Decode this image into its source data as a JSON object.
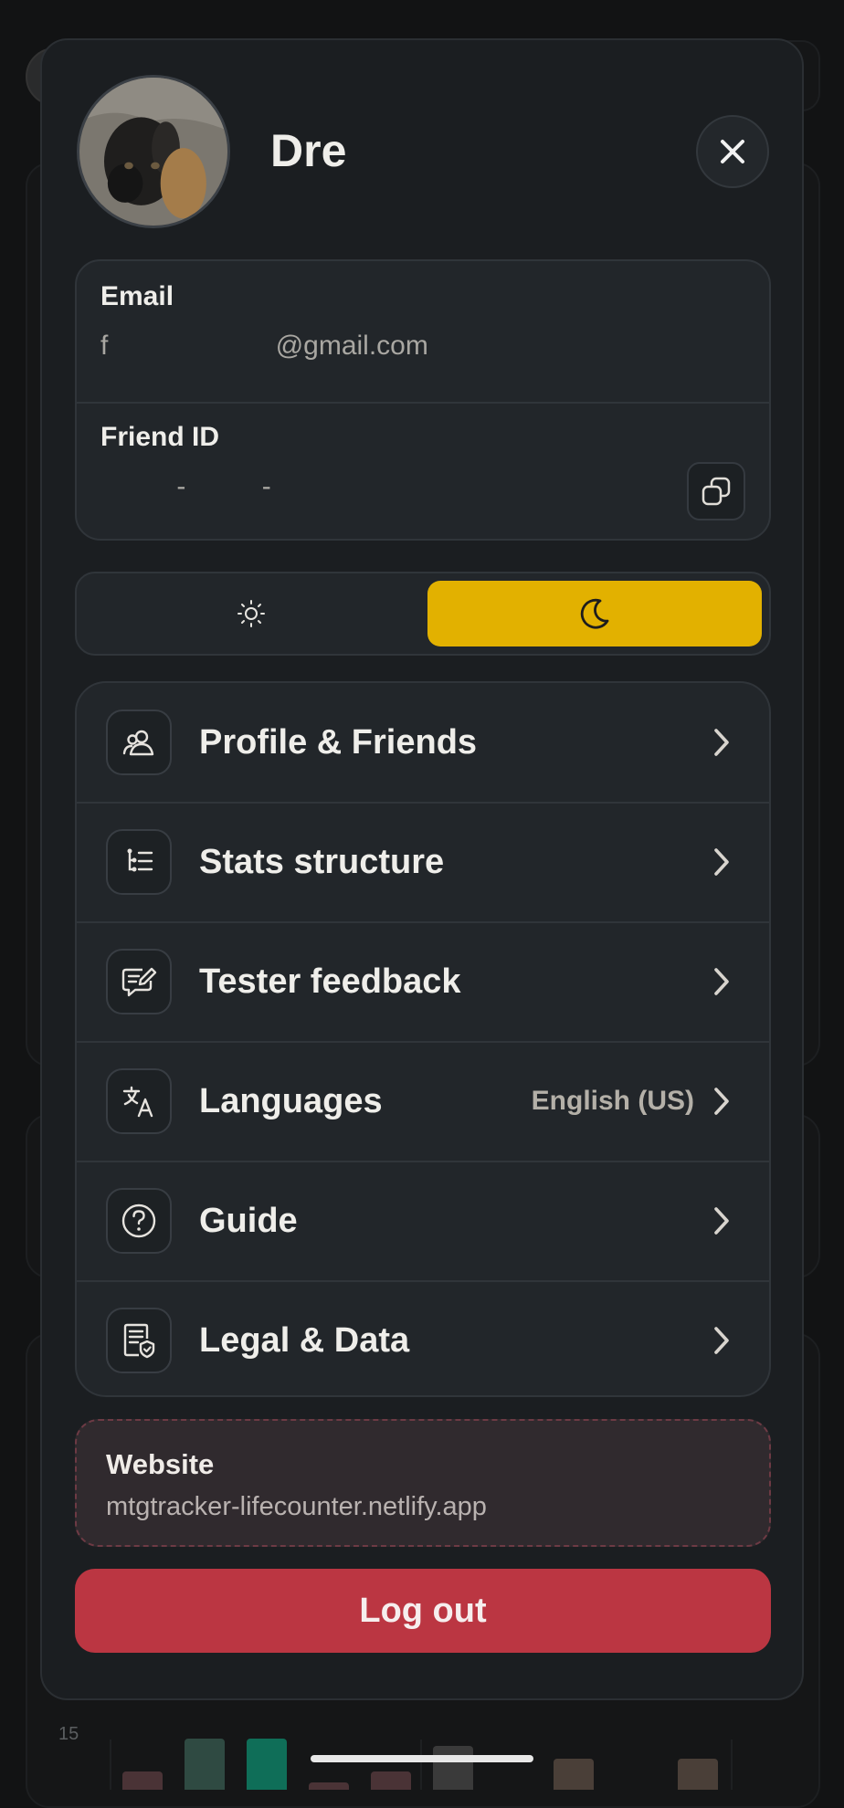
{
  "profile": {
    "name": "Dre",
    "avatar_alt": "user-avatar-photo"
  },
  "account": {
    "email_label": "Email",
    "email_value": "f                      @gmail.com",
    "friend_id_label": "Friend ID",
    "friend_id_value": "          -          -"
  },
  "theme": {
    "options": [
      "light",
      "dark"
    ],
    "selected": "dark",
    "accent": "#e2b100"
  },
  "menu": {
    "items": [
      {
        "label": "Profile & Friends",
        "icon": "users-icon",
        "value": ""
      },
      {
        "label": "Stats structure",
        "icon": "list-tree-icon",
        "value": ""
      },
      {
        "label": "Tester feedback",
        "icon": "feedback-pencil-icon",
        "value": ""
      },
      {
        "label": "Languages",
        "icon": "translate-icon",
        "value": "English (US)"
      },
      {
        "label": "Guide",
        "icon": "help-circle-icon",
        "value": ""
      },
      {
        "label": "Legal & Data",
        "icon": "legal-document-icon",
        "value": ""
      }
    ]
  },
  "website": {
    "label": "Website",
    "url": "mtgtracker-lifecounter.netlify.app"
  },
  "logout": {
    "label": "Log out",
    "color": "#bb3642"
  }
}
